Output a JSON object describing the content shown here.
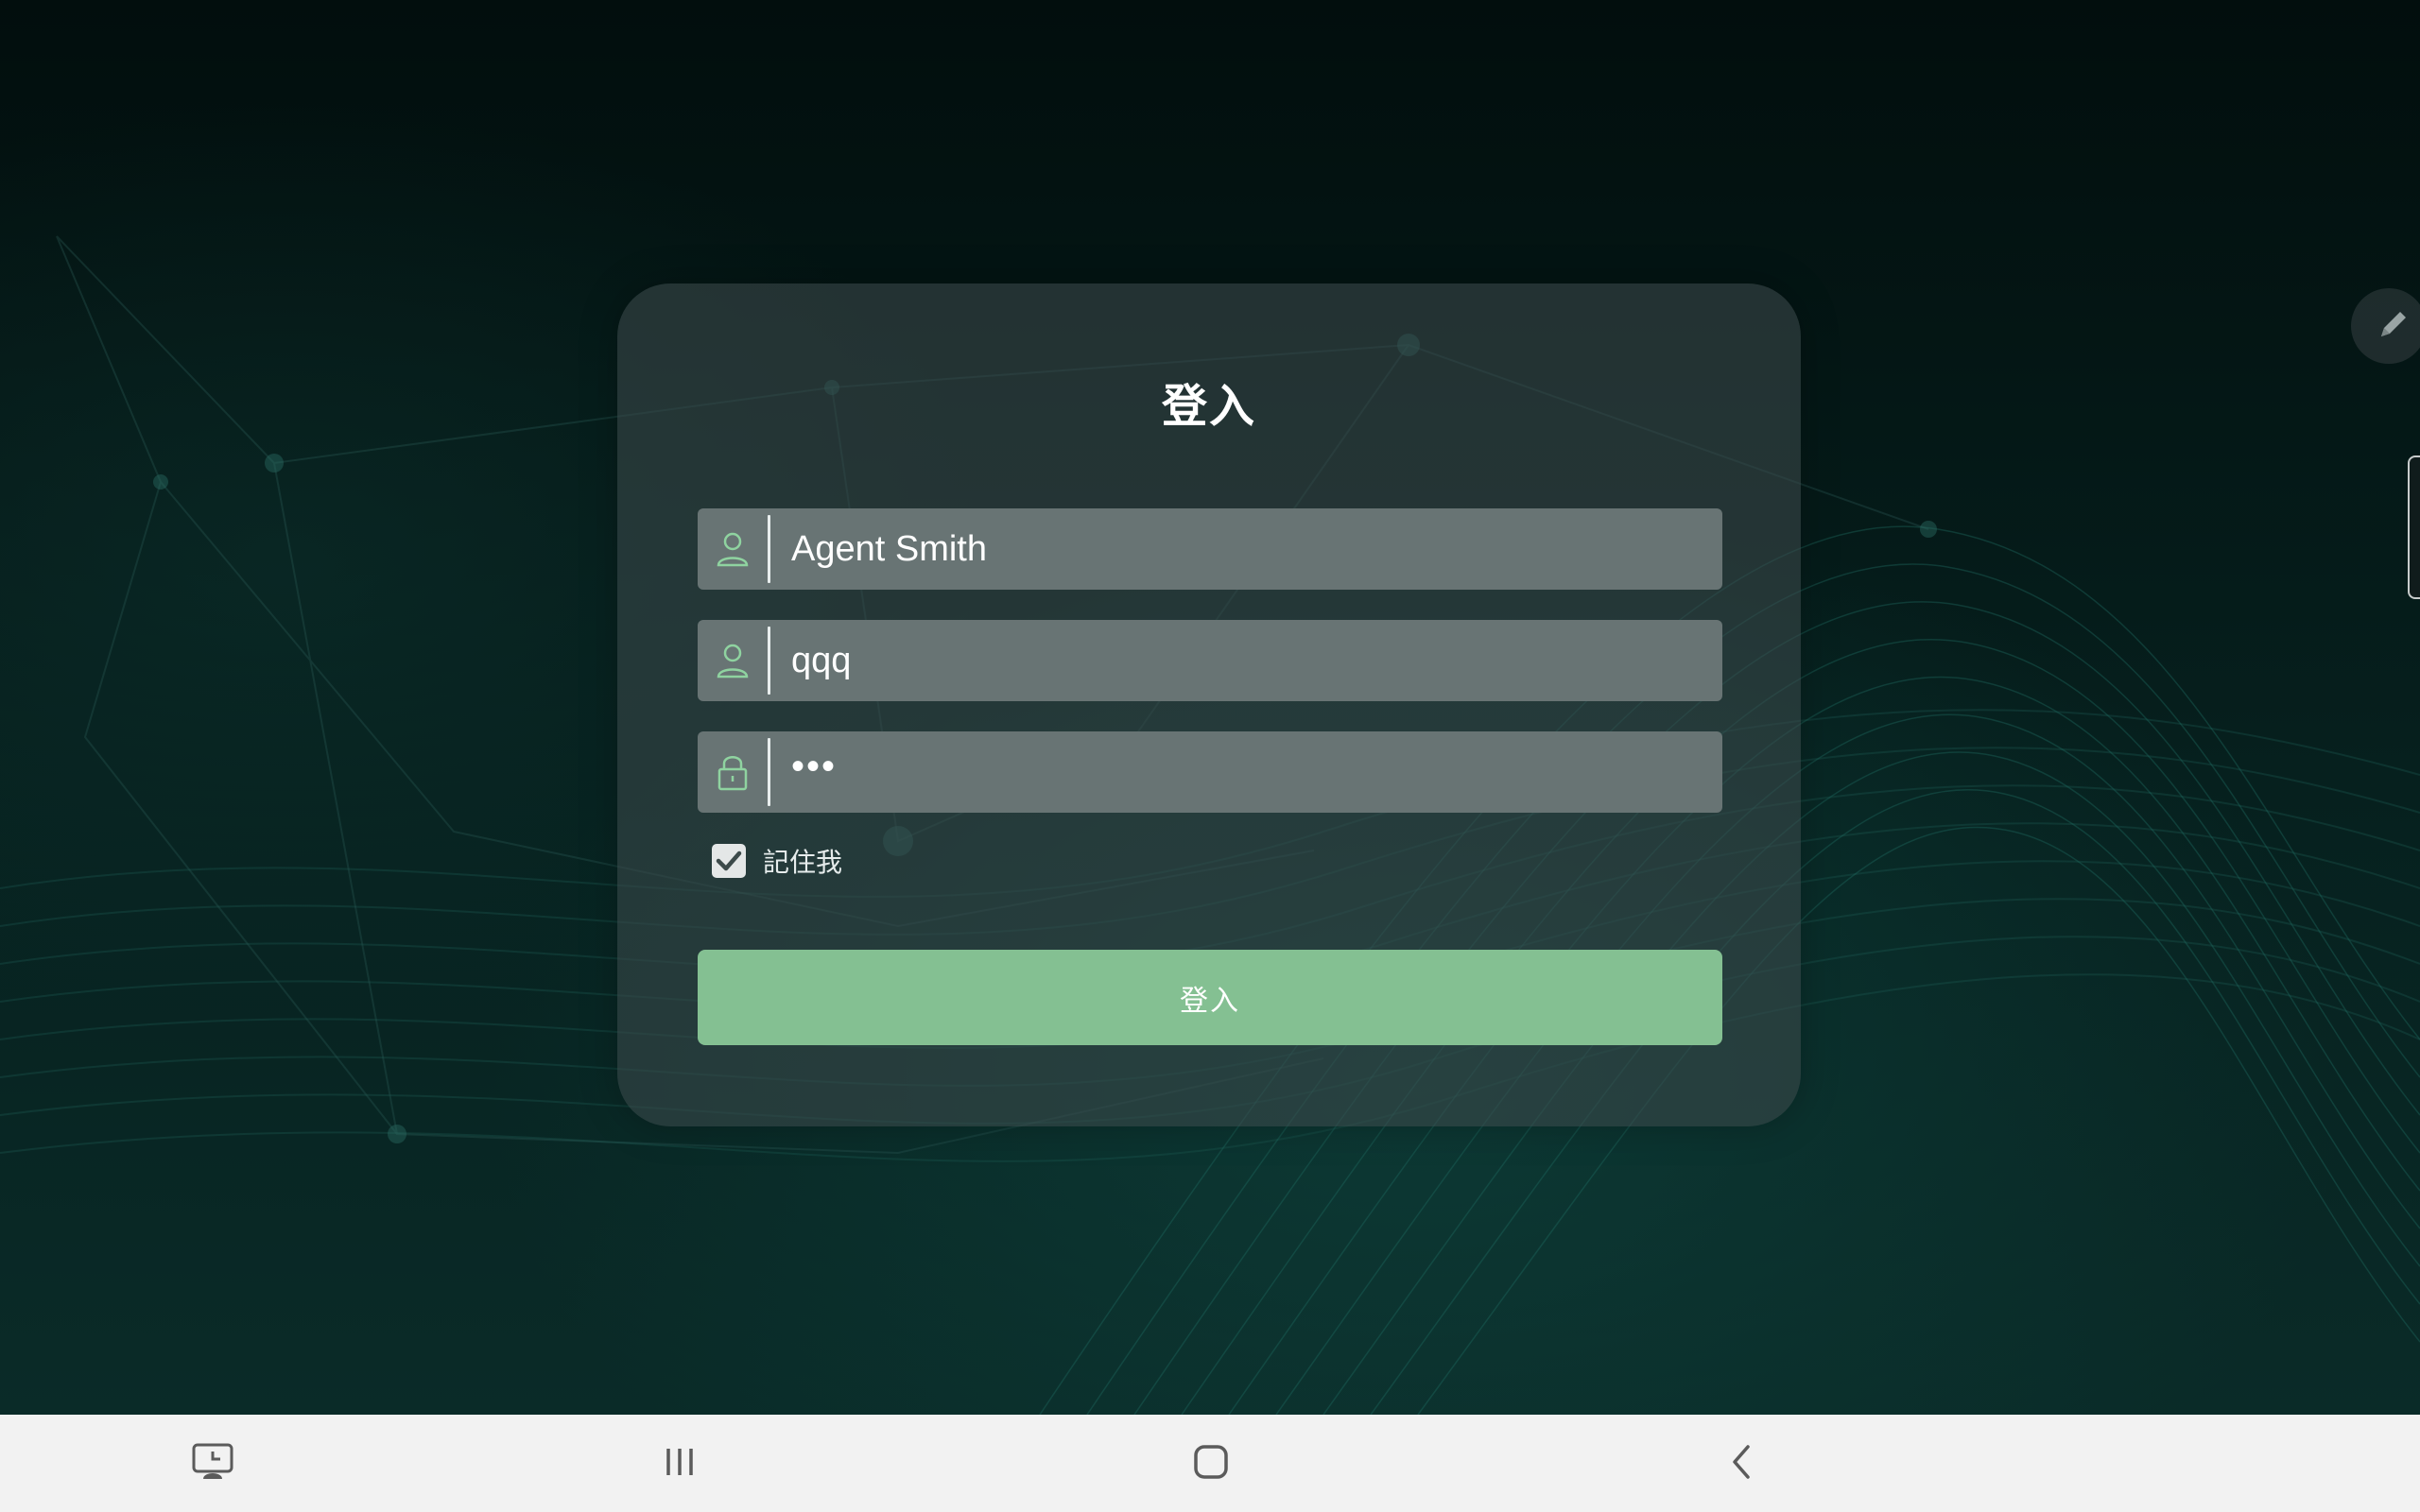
{
  "login": {
    "title": "登入",
    "fields": [
      {
        "icon": "user-icon",
        "value": "Agent Smith"
      },
      {
        "icon": "user-icon",
        "value": "qqq"
      },
      {
        "icon": "lock-icon",
        "value": "•••"
      }
    ],
    "remember_me": {
      "label": "記住我",
      "checked": true
    },
    "submit_label": "登入"
  },
  "navbar": {
    "buttons": [
      "screen-recorder-icon",
      "recent-apps-icon",
      "home-icon",
      "back-icon"
    ]
  },
  "colors": {
    "accent": "#84c092",
    "card": "#3a484a",
    "field": "#687474",
    "background": "#041412"
  }
}
